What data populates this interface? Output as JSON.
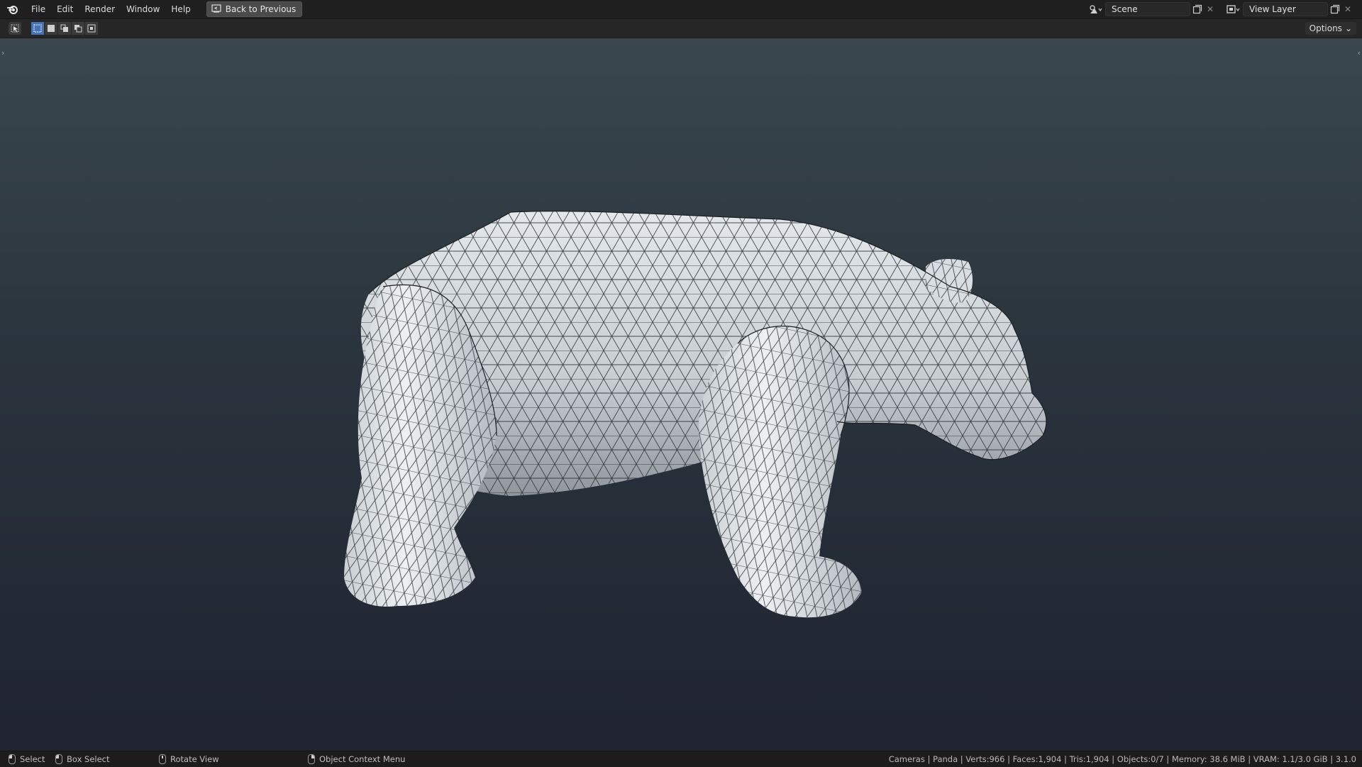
{
  "menu": {
    "items": [
      "File",
      "Edit",
      "Render",
      "Window",
      "Help"
    ],
    "back_button": "Back to Previous"
  },
  "scene": {
    "name": "Scene"
  },
  "view_layer": {
    "name": "View Layer"
  },
  "header2": {
    "options_label": "Options"
  },
  "status": {
    "select": "Select",
    "box_select": "Box Select",
    "rotate_view": "Rotate View",
    "context_menu": "Object Context Menu",
    "stats": "Cameras | Panda | Verts:966 | Faces:1,904 | Tris:1,904 | Objects:0/7 | Memory: 38.6 MiB | VRAM: 1.1/3.0 GiB | 3.1.0"
  },
  "colors": {
    "accent": "#4772b3",
    "viewport_top": "#3a474f",
    "viewport_bottom": "#1f2430",
    "mesh_fill": "#dfe3e6",
    "wire": "#1c1f22"
  },
  "icons": {
    "logo": "blender-logo-icon",
    "back": "back-icon",
    "scene": "scene-icon",
    "view_layer": "view-layer-icon",
    "duplicate": "duplicate-icon",
    "close": "close-icon",
    "select_tool": "select-tool-icon"
  }
}
